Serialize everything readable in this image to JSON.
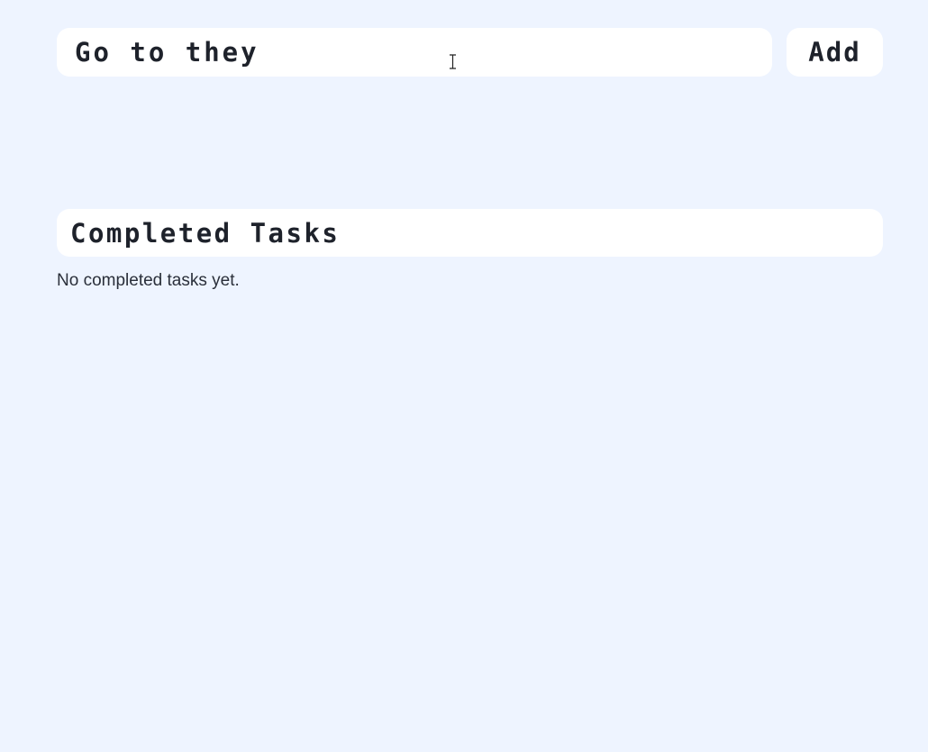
{
  "new_task": {
    "input_value": "Go to they ",
    "add_label": "Add"
  },
  "completed": {
    "title": "Completed Tasks",
    "empty_text": "No completed tasks yet."
  },
  "icons": {
    "cursor": "text-cursor-icon"
  },
  "colors": {
    "background": "#eef4ff",
    "surface": "#ffffff",
    "text": "#1e222b"
  }
}
